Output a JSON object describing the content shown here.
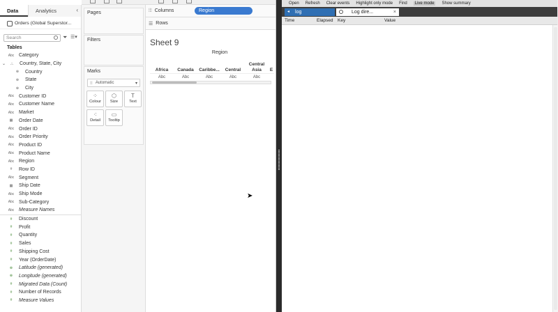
{
  "left_tabs": {
    "data": "Data",
    "analytics": "Analytics"
  },
  "datasource": "Orders (Global Superstor...",
  "search": {
    "placeholder": "Search"
  },
  "tables_header": "Tables",
  "fields": [
    {
      "type": "Abc",
      "label": "Category"
    },
    {
      "type": "hier",
      "label": "Country, State, City"
    },
    {
      "type": "geo",
      "label": "Country"
    },
    {
      "type": "geo",
      "label": "State"
    },
    {
      "type": "geo",
      "label": "City"
    },
    {
      "type": "Abc",
      "label": "Customer ID"
    },
    {
      "type": "Abc",
      "label": "Customer Name"
    },
    {
      "type": "Abc",
      "label": "Market"
    },
    {
      "type": "date",
      "label": "Order Date"
    },
    {
      "type": "Abc",
      "label": "Order ID"
    },
    {
      "type": "Abc",
      "label": "Order Priority"
    },
    {
      "type": "Abc",
      "label": "Product ID"
    },
    {
      "type": "Abc",
      "label": "Product Name"
    },
    {
      "type": "Abc",
      "label": "Region"
    },
    {
      "type": "#",
      "label": "Row ID"
    },
    {
      "type": "Abc",
      "label": "Segment"
    },
    {
      "type": "date",
      "label": "Ship Date"
    },
    {
      "type": "Abc",
      "label": "Ship Mode"
    },
    {
      "type": "Abc",
      "label": "Sub-Category"
    },
    {
      "type": "Abc",
      "label": "Measure Names"
    }
  ],
  "measures": [
    {
      "type": "#",
      "label": "Discount"
    },
    {
      "type": "#",
      "label": "Profit"
    },
    {
      "type": "#",
      "label": "Quantity"
    },
    {
      "type": "#",
      "label": "Sales"
    },
    {
      "type": "#",
      "label": "Shipping Cost"
    },
    {
      "type": "#",
      "label": "Year (OrderDate)"
    },
    {
      "type": "geo",
      "label": "Latitude (generated)"
    },
    {
      "type": "geo",
      "label": "Longitude (generated)"
    },
    {
      "type": "#",
      "label": "Migrated Data (Count)"
    },
    {
      "type": "#",
      "label": "Number of Records"
    },
    {
      "type": "#",
      "label": "Measure Values"
    }
  ],
  "cards": {
    "pages": "Pages",
    "filters": "Filters",
    "marks": "Marks"
  },
  "marks": {
    "type": "Automatic",
    "buttons": [
      "Colour",
      "Size",
      "Text",
      "Detail",
      "Tooltip"
    ]
  },
  "shelves": {
    "columns": "Columns",
    "rows": "Rows",
    "columns_pill": "Region"
  },
  "sheet": {
    "title": "Sheet 9",
    "header": "Region",
    "columns": [
      "Africa",
      "Canada",
      "Caribbe...",
      "Central",
      "Central Asia",
      "E"
    ],
    "cell": "Abc"
  },
  "log": {
    "menu": [
      "Open",
      "Refresh",
      "Clear events",
      "Highlight only mode",
      "Find",
      "Live mode",
      "Show summary"
    ],
    "active_menu": "Live mode",
    "tab1": "log",
    "tab2": "Log dire...",
    "headers": [
      "Time",
      "Elapsed",
      "Key",
      "Value"
    ]
  }
}
